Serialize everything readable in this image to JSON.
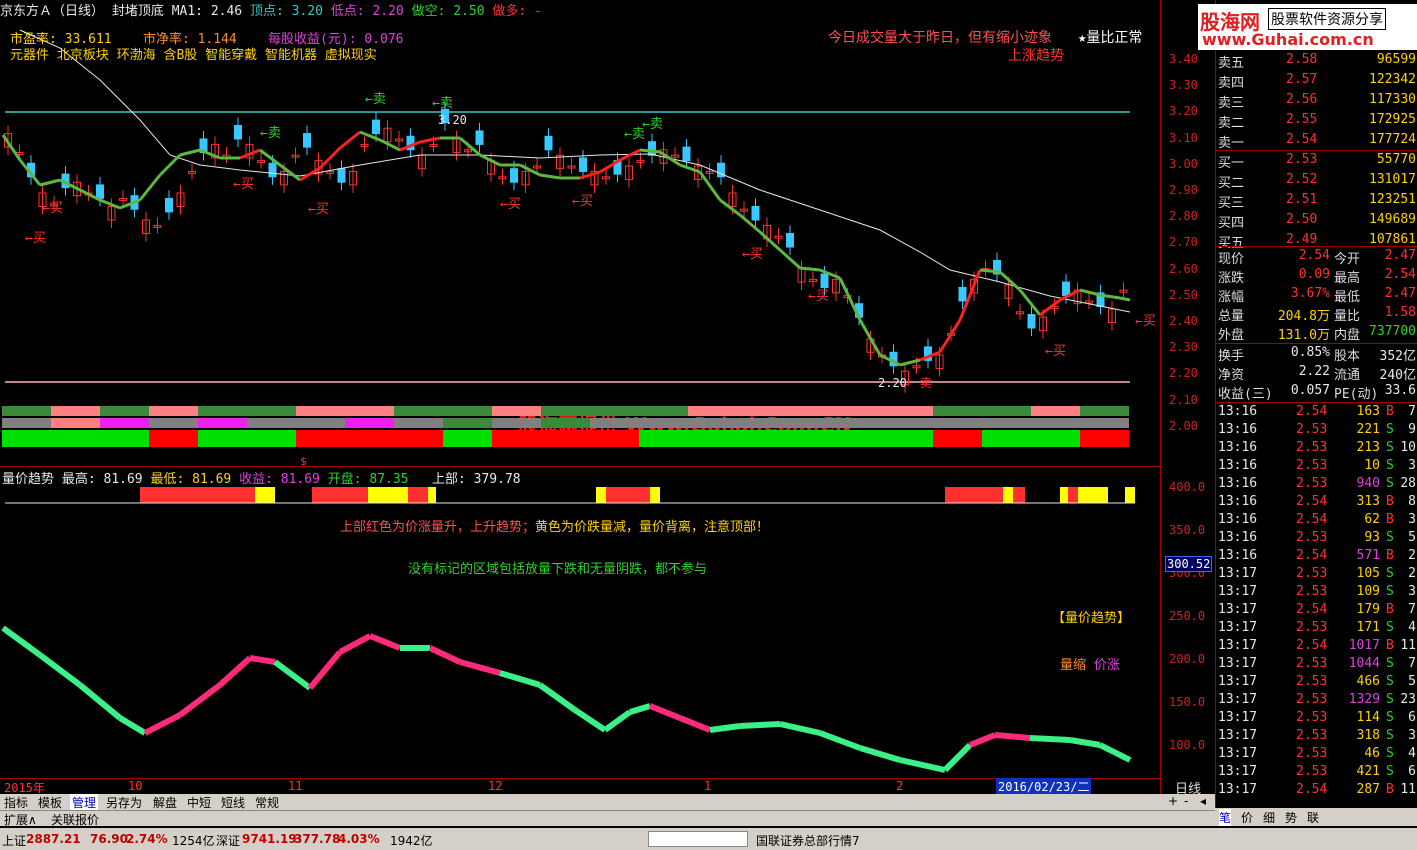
{
  "title": {
    "name": "京东方Ａ（日线）",
    "indicator": "封堵顶底",
    "ma1_label": "MA1: 2.46",
    "top_label": "顶点: 3.20",
    "low_label": "低点: 2.20",
    "short_label": "做空: 2.50",
    "long_label": "做多: -"
  },
  "fundamentals": {
    "pe": "市盈率: 33.611",
    "pb": "市净率: 1.144",
    "eps": "每股收益(元): 0.076"
  },
  "plates": "元器件 北京板块 环渤海 含B股 智能穿戴 智能机器 虚拟现实",
  "alerts": {
    "a1": "今日成交量大于昨日，但有缩小迹象",
    "a2": "★量比正常",
    "a3": "上涨趋势"
  },
  "price_axis": [
    "3.40",
    "3.30",
    "3.20",
    "3.10",
    "3.00",
    "2.90",
    "2.80",
    "2.70",
    "2.60",
    "2.50",
    "2.40",
    "2.30",
    "2.20",
    "2.10",
    "2.00"
  ],
  "ind_axis": [
    "400.0",
    "350.0",
    "300.0",
    "250.0",
    "200.0",
    "150.0",
    "100.0"
  ],
  "annotations": {
    "sell": "←卖",
    "buy": "←买",
    "top": "3.20",
    "bottom": "2.20",
    "low_sell": "卖",
    "dollar": "$"
  },
  "watermark": "股海网提供 Www.Guhai.Com.CN",
  "indicator": {
    "title": "量价趋势",
    "high": "最高: 81.69",
    "low": "最低: 81.69",
    "ret": "收益: 81.69",
    "open": "开盘: 87.35",
    "upper": "上部: 379.78"
  },
  "notes": {
    "n1": "上部红色为价涨量升，上升趋势；",
    "n1b": "黄色为价跌量减，量价背离，注意顶部！",
    "n2": "没有标记的区域包括放量下跌和无量阴跌，都不参与",
    "n3": "【量价趋势】",
    "n4a": "量缩",
    "n4b": "价涨"
  },
  "pricebox": "300.52",
  "dates": {
    "y2015": "2015年",
    "m10": "10",
    "m11": "11",
    "m12": "12",
    "m1": "1",
    "m2": "2",
    "cursor": "2016/02/23/二",
    "period": "日线"
  },
  "tabs": [
    "指标",
    "模板",
    "管理",
    "另存为",
    "解盘",
    "中短",
    "短线",
    "常规"
  ],
  "tabs2": [
    "扩展∧",
    "关联报价"
  ],
  "status": {
    "sh": "上证",
    "sh_val": "2887.21",
    "sh_chg": "76.90",
    "sh_pct": "2.74%",
    "sh_amt": "1254亿",
    "sz": "深证",
    "sz_val": "9741.19",
    "sz_chg": "377.78",
    "sz_pct": "4.03%",
    "sz_amt": "1942亿",
    "broker": "国联证券总部行情7"
  },
  "logo": {
    "brand": "股海网",
    "brand2": "股票软件资源分享",
    "url": "www.Guhai.com.cn"
  },
  "sells": [
    [
      "卖五",
      "2.58",
      "96599"
    ],
    [
      "卖四",
      "2.57",
      "122342"
    ],
    [
      "卖三",
      "2.56",
      "117330"
    ],
    [
      "卖二",
      "2.55",
      "172925"
    ],
    [
      "卖一",
      "2.54",
      "177724"
    ]
  ],
  "buys": [
    [
      "买一",
      "2.53",
      "55770"
    ],
    [
      "买二",
      "2.52",
      "131017"
    ],
    [
      "买三",
      "2.51",
      "123251"
    ],
    [
      "买四",
      "2.50",
      "149689"
    ],
    [
      "买五",
      "2.49",
      "107861"
    ]
  ],
  "quote": [
    [
      "现价",
      "2.54",
      "今开",
      "2.47"
    ],
    [
      "涨跌",
      "0.09",
      "最高",
      "2.54"
    ],
    [
      "涨幅",
      "3.67%",
      "最低",
      "2.47"
    ],
    [
      "总量",
      "204.8万",
      "量比",
      "1.58"
    ],
    [
      "外盘",
      "131.0万",
      "内盘",
      "737700"
    ]
  ],
  "stats": [
    [
      "换手",
      "0.85%",
      "股本",
      "352亿"
    ],
    [
      "净资",
      "2.22",
      "流通",
      "240亿"
    ],
    [
      "收益(三)",
      "0.057",
      "PE(动)",
      "33.6"
    ]
  ],
  "ticks": [
    [
      "13:16",
      "2.54",
      "163",
      "B",
      "7"
    ],
    [
      "13:16",
      "2.53",
      "221",
      "S",
      "9"
    ],
    [
      "13:16",
      "2.53",
      "213",
      "S",
      "10"
    ],
    [
      "13:16",
      "2.53",
      "10",
      "S",
      "3"
    ],
    [
      "13:16",
      "2.53",
      "940",
      "S",
      "28"
    ],
    [
      "13:16",
      "2.54",
      "313",
      "B",
      "8"
    ],
    [
      "13:16",
      "2.54",
      "62",
      "B",
      "3"
    ],
    [
      "13:16",
      "2.53",
      "93",
      "S",
      "5"
    ],
    [
      "13:16",
      "2.54",
      "571",
      "B",
      "2"
    ],
    [
      "13:17",
      "2.53",
      "105",
      "S",
      "2"
    ],
    [
      "13:17",
      "2.53",
      "109",
      "S",
      "3"
    ],
    [
      "13:17",
      "2.54",
      "179",
      "B",
      "7"
    ],
    [
      "13:17",
      "2.53",
      "171",
      "S",
      "4"
    ],
    [
      "13:17",
      "2.54",
      "1017",
      "B",
      "11"
    ],
    [
      "13:17",
      "2.53",
      "1044",
      "S",
      "7"
    ],
    [
      "13:17",
      "2.53",
      "466",
      "S",
      "5"
    ],
    [
      "13:17",
      "2.53",
      "1329",
      "S",
      "23"
    ],
    [
      "13:17",
      "2.53",
      "114",
      "S",
      "6"
    ],
    [
      "13:17",
      "2.53",
      "318",
      "S",
      "3"
    ],
    [
      "13:17",
      "2.53",
      "46",
      "S",
      "4"
    ],
    [
      "13:17",
      "2.53",
      "421",
      "S",
      "6"
    ],
    [
      "13:17",
      "2.54",
      "287",
      "B",
      "11"
    ]
  ],
  "rtabs": [
    "笔",
    "价",
    "细",
    "势",
    "联"
  ],
  "colors": {
    "red": "#ff3030",
    "green": "#30d030",
    "yellow": "#ffd200",
    "cyan": "#38c8c8",
    "magenta": "#e040e0",
    "bg": "#000000"
  }
}
